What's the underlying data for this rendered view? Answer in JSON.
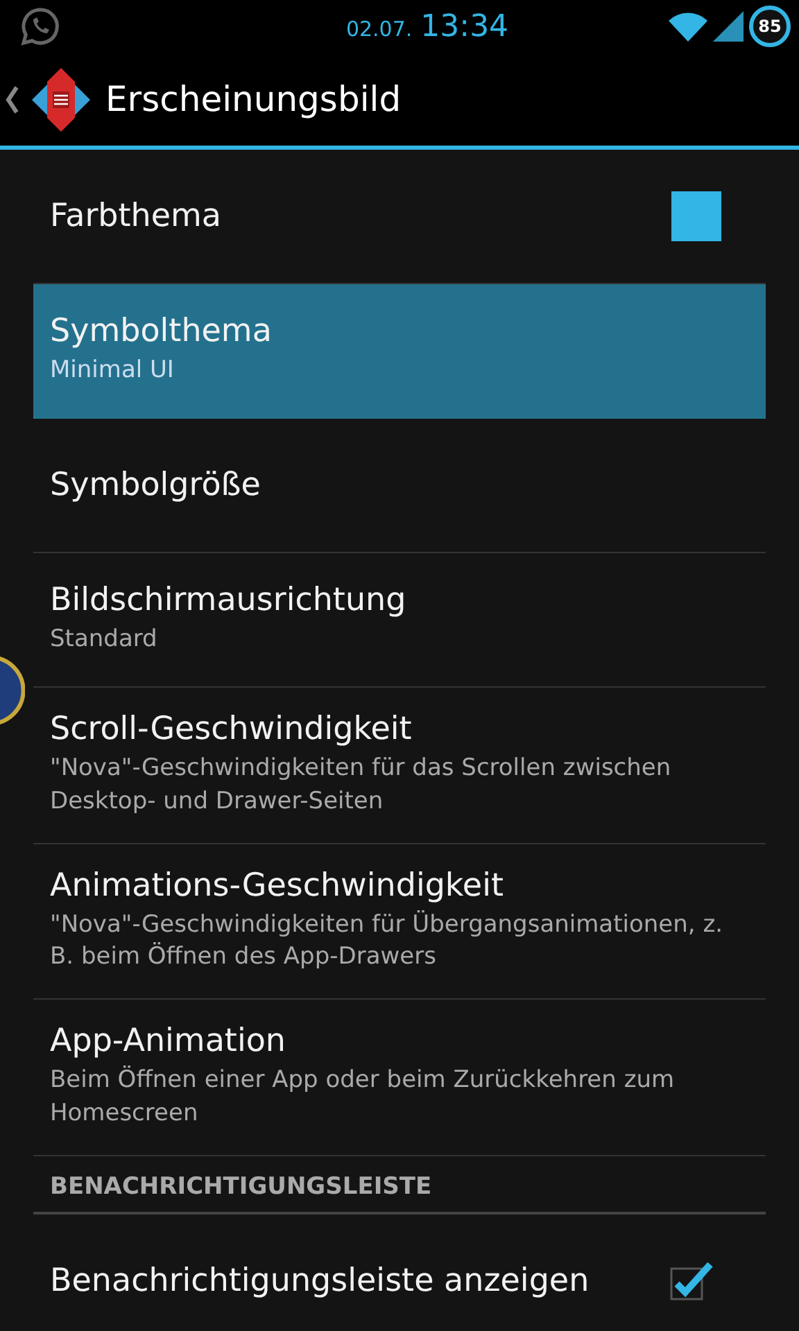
{
  "status_bar": {
    "date": "02.07.",
    "time": "13:34",
    "battery": "85"
  },
  "action_bar": {
    "title": "Erscheinungsbild"
  },
  "items": [
    {
      "kind": "color",
      "title": "Farbthema",
      "color": "#33b5e5",
      "selected": false
    },
    {
      "kind": "plain",
      "title": "Symbolthema",
      "summary": "Minimal UI",
      "selected": true
    },
    {
      "kind": "plain",
      "title": "Symbolgröße",
      "selected": false
    },
    {
      "kind": "plain",
      "title": "Bildschirmausrichtung",
      "summary": "Standard",
      "selected": false
    },
    {
      "kind": "plain",
      "title": "Scroll-Geschwindigkeit",
      "summary": "\"Nova\"-Geschwindigkeiten für das Scrollen zwischen Desktop- und Drawer-Seiten",
      "selected": false
    },
    {
      "kind": "plain",
      "title": "Animations-Geschwindigkeit",
      "summary": "\"Nova\"-Geschwindigkeiten für Übergangsanimationen, z. B. beim Öffnen des App-Drawers",
      "selected": false
    },
    {
      "kind": "plain",
      "title": "App-Animation",
      "summary": "Beim Öffnen einer App oder beim Zurückkehren zum Homescreen",
      "selected": false
    },
    {
      "kind": "header",
      "title": "BENACHRICHTIGUNGSLEISTE"
    },
    {
      "kind": "checkbox",
      "title": "Benachrichtigungsleiste anzeigen",
      "checked": true,
      "selected": false
    }
  ]
}
